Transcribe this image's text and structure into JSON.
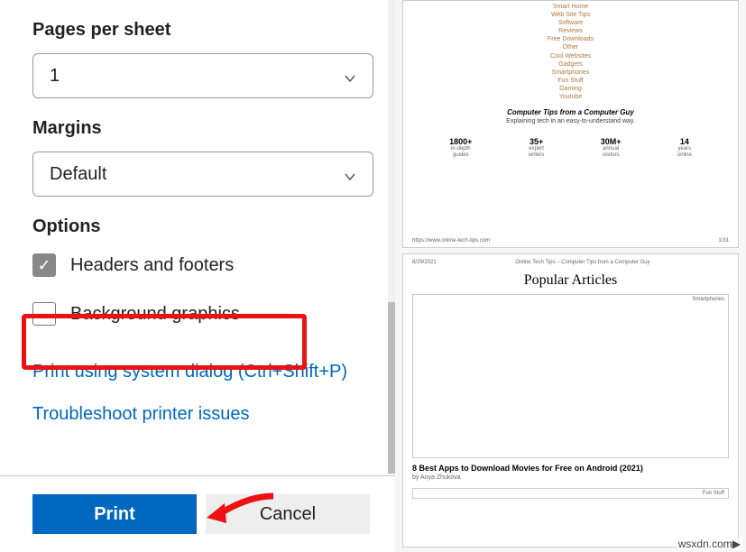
{
  "sections": {
    "pages_per_sheet_label": "Pages per sheet",
    "pages_per_sheet_value": "1",
    "margins_label": "Margins",
    "margins_value": "Default",
    "options_label": "Options"
  },
  "options": {
    "headers": {
      "label": "Headers and footers",
      "checked": true
    },
    "background": {
      "label": "Background graphics",
      "checked": false
    }
  },
  "links": {
    "system_dialog": "Print using system dialog (Ctrl+Shift+P)",
    "troubleshoot": "Troubleshoot printer issues"
  },
  "buttons": {
    "print": "Print",
    "cancel": "Cancel"
  },
  "preview": {
    "page1": {
      "categories": [
        "Smart Home",
        "Web Site Tips",
        "Software",
        "Reviews",
        "Free Downloads",
        "Other",
        "Cool Websites",
        "Gadgets",
        "Smartphones",
        "Fun Stuff",
        "Gaming",
        "Youtube"
      ],
      "subtitle": "Computer Tips from a Computer Guy",
      "tagline": "Explaining tech in an easy-to-understand way.",
      "stats": [
        {
          "num": "1800+",
          "label1": "in-depth",
          "label2": "guides"
        },
        {
          "num": "35+",
          "label1": "expert",
          "label2": "writers"
        },
        {
          "num": "30M+",
          "label1": "annual",
          "label2": "visitors"
        },
        {
          "num": "14",
          "label1": "years",
          "label2": "online"
        }
      ],
      "footer_url": "https://www.online-tech-tips.com",
      "footer_page": "1/31"
    },
    "page2": {
      "header_date": "8/29/2021",
      "header_title": "Online Tech Tips – Computer Tips from a Computer Guy",
      "heading": "Popular Articles",
      "thumb1_label": "Smartphones",
      "article_title": "8 Best Apps to Download Movies for Free on Android (2021)",
      "article_by": "by Anya Zhukova",
      "thumb2_label": "Fun Stuff"
    }
  },
  "watermark": "wsxdn.com"
}
